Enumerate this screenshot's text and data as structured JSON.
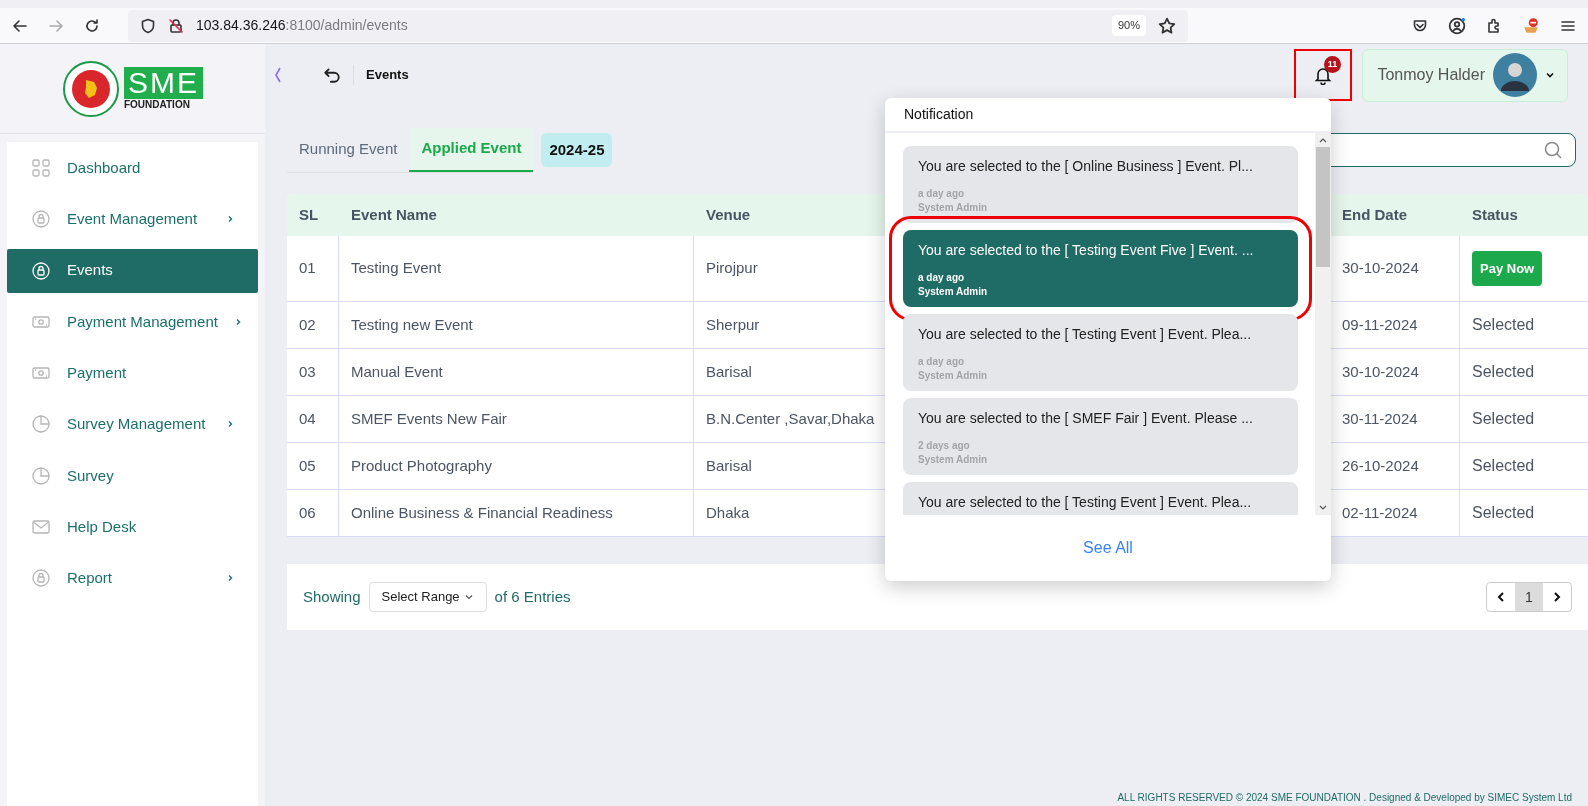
{
  "browser": {
    "url_host": "103.84.36.246",
    "url_rest": ":8100/admin/events",
    "zoom": "90%"
  },
  "logo": {
    "text": "SME",
    "subtitle": "FOUNDATION"
  },
  "header": {
    "title": "Events",
    "notification_count": "11",
    "bell_highlighted": true,
    "user_name": "Tonmoy Halder"
  },
  "sidebar": {
    "items": [
      {
        "label": "Dashboard",
        "has_submenu": false,
        "selected": false
      },
      {
        "label": "Event Management",
        "has_submenu": true,
        "selected": false
      },
      {
        "label": "Events",
        "has_submenu": false,
        "selected": true
      },
      {
        "label": "Payment Management",
        "has_submenu": true,
        "selected": false
      },
      {
        "label": "Payment",
        "has_submenu": false,
        "selected": false
      },
      {
        "label": "Survey Management",
        "has_submenu": true,
        "selected": false
      },
      {
        "label": "Survey",
        "has_submenu": false,
        "selected": false
      },
      {
        "label": "Help Desk",
        "has_submenu": false,
        "selected": false
      },
      {
        "label": "Report",
        "has_submenu": true,
        "selected": false
      }
    ]
  },
  "tabs": [
    {
      "label": "Running Event",
      "selected": false
    },
    {
      "label": "Applied Event",
      "selected": true
    }
  ],
  "year_badge": "2024-25",
  "table": {
    "columns": [
      "SL",
      "Event Name",
      "Venue",
      "End Date",
      "Status"
    ],
    "rows": [
      {
        "sl": "01",
        "name": "Testing Event",
        "venue": "Pirojpur",
        "end_date": "30-10-2024",
        "status": "Pay Now",
        "kind": "button"
      },
      {
        "sl": "02",
        "name": "Testing new Event",
        "venue": "Sherpur",
        "end_date": "09-11-2024",
        "status": "Selected",
        "kind": "text"
      },
      {
        "sl": "03",
        "name": "Manual Event",
        "venue": "Barisal",
        "end_date": "30-10-2024",
        "status": "Selected",
        "kind": "text"
      },
      {
        "sl": "04",
        "name": "SMEF Events New Fair",
        "venue": "B.N.Center ,Savar,Dhaka",
        "end_date": "30-11-2024",
        "status": "Selected",
        "kind": "text"
      },
      {
        "sl": "05",
        "name": "Product Photography",
        "venue": "Barisal",
        "end_date": "26-10-2024",
        "status": "Selected",
        "kind": "text"
      },
      {
        "sl": "06",
        "name": "Online Business & Financial Readiness",
        "venue": "Dhaka",
        "end_date": "02-11-2024",
        "status": "Selected",
        "kind": "text"
      }
    ]
  },
  "pagination": {
    "showing": "Showing",
    "range_select": "Select Range",
    "entries": "of 6 Entries",
    "pages": [
      {
        "label": "1",
        "selected": true
      }
    ]
  },
  "notifications": {
    "title": "Notification",
    "see_all": "See All",
    "items": [
      {
        "message": "You are selected to the [ Online Business ] Event. Pl...",
        "time": "a day ago",
        "sender": "System Admin",
        "selected": false,
        "highlighted": false
      },
      {
        "message": "You are selected to the [ Testing Event Five ] Event. ...",
        "time": "a day ago",
        "sender": "System Admin",
        "selected": true,
        "highlighted": true
      },
      {
        "message": "You are selected to the [ Testing Event ] Event. Plea...",
        "time": "a day ago",
        "sender": "System Admin",
        "selected": false,
        "highlighted": false
      },
      {
        "message": "You are selected to the [ SMEF Fair ] Event. Please ...",
        "time": "2 days ago",
        "sender": "System Admin",
        "selected": false,
        "highlighted": false
      },
      {
        "message": "You are selected to the [ Testing Event ] Event. Plea...",
        "selected": false,
        "highlighted": false
      }
    ]
  },
  "footer": "ALL RIGHTS RESERVED © 2024 SME FOUNDATION . Designed & Developed by SIMEC System Ltd"
}
